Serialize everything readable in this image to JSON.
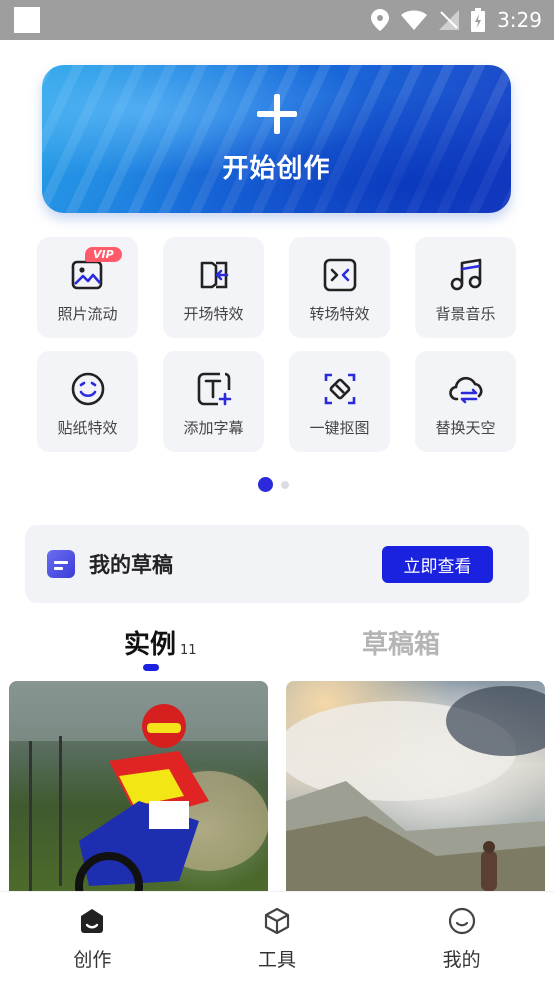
{
  "status_bar": {
    "time": "3:29"
  },
  "banner": {
    "title": "开始创作"
  },
  "tools": [
    {
      "label": "照片流动",
      "icon": "photo-flow-icon",
      "badge": "VIP"
    },
    {
      "label": "开场特效",
      "icon": "intro-effect-icon"
    },
    {
      "label": "转场特效",
      "icon": "transition-effect-icon"
    },
    {
      "label": "背景音乐",
      "icon": "music-note-icon"
    },
    {
      "label": "贴纸特效",
      "icon": "sticker-smile-icon"
    },
    {
      "label": "添加字幕",
      "icon": "add-subtitle-icon"
    },
    {
      "label": "一键抠图",
      "icon": "cutout-icon"
    },
    {
      "label": "替换天空",
      "icon": "replace-sky-icon"
    }
  ],
  "pager": {
    "pages": 2,
    "current": 1
  },
  "drafts": {
    "title": "我的草稿",
    "button": "立即查看"
  },
  "tabs": {
    "examples": {
      "label": "实例",
      "count": "11"
    },
    "drafts": {
      "label": "草稿箱"
    }
  },
  "nav": [
    {
      "label": "创作",
      "icon": "create-icon"
    },
    {
      "label": "工具",
      "icon": "tools-cube-icon"
    },
    {
      "label": "我的",
      "icon": "profile-smile-icon"
    }
  ],
  "colors": {
    "accent": "#1a22e0",
    "vip": "#ff5a6a"
  }
}
